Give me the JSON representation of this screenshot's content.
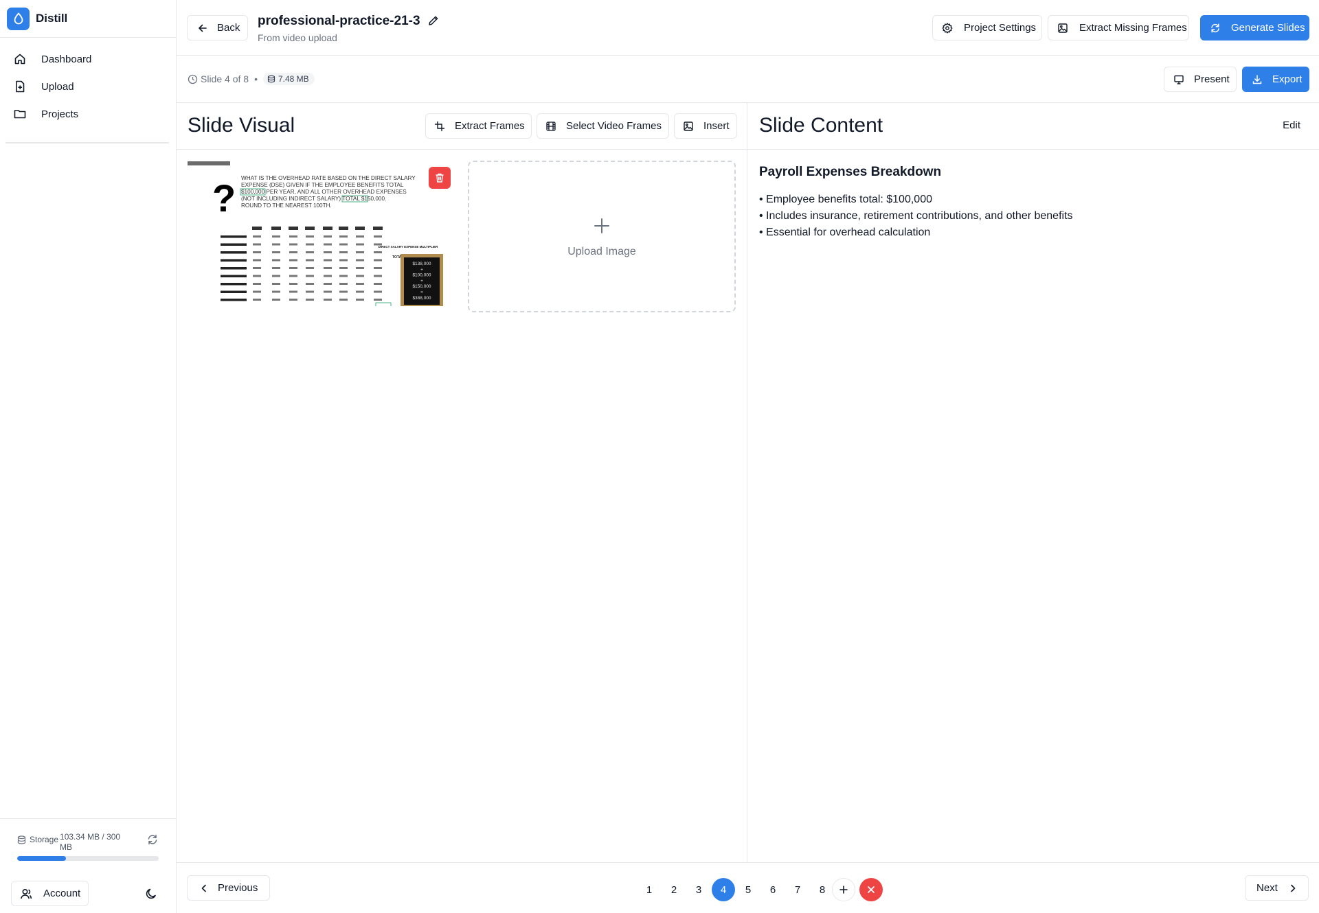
{
  "app": {
    "name": "Distill",
    "accent": "#2f7fe8",
    "danger": "#ef4444"
  },
  "sidebar": {
    "items": [
      {
        "label": "Dashboard",
        "icon": "home-icon"
      },
      {
        "label": "Upload",
        "icon": "file-plus-icon"
      },
      {
        "label": "Projects",
        "icon": "folder-icon"
      }
    ],
    "storage": {
      "label": "Storage",
      "value": "103.34 MB / 300 MB",
      "used_fraction": 0.344
    },
    "account_label": "Account"
  },
  "header": {
    "back_label": "Back",
    "project_title": "professional-practice-21-3",
    "project_subtitle": "From video upload",
    "project_settings_label": "Project Settings",
    "extract_missing_label": "Extract Missing Frames",
    "generate_label": "Generate Slides"
  },
  "subbar": {
    "slide_indicator": "Slide 4 of 8",
    "separator": "•",
    "file_size": "7.48 MB",
    "present_label": "Present",
    "export_label": "Export"
  },
  "visual": {
    "title": "Slide Visual",
    "extract_frames_label": "Extract Frames",
    "select_video_frames_label": "Select Video Frames",
    "insert_label": "Insert",
    "upload_label": "Upload Image",
    "frame": {
      "question_mark": "?",
      "question_lines": [
        "WHAT IS THE OVERHEAD RATE BASED ON THE DIRECT SALARY",
        "EXPENSE (DSE) GIVEN IF THE EMPLOYEE BENEFITS TOTAL",
        "$100,000 PER YEAR, AND ALL OTHER OVERHEAD EXPENSES",
        "(NOT INCLUDING INDIRECT SALARY) TOTAL $150,000.",
        "ROUND TO THE NEAREST 100TH."
      ],
      "total_overhead_label": "TOTAL OVERHEAD",
      "board_lines": [
        "$138,000",
        "+",
        "$100,000",
        "+",
        "$150,000",
        "=",
        "$388,000"
      ],
      "multiplier_label": "DIRECT SALARY EXPENSE MULTIPLIER"
    }
  },
  "content": {
    "title": "Slide Content",
    "edit_label": "Edit",
    "heading": "Payroll Expenses Breakdown",
    "bullets": [
      "• Employee benefits total: $100,000",
      "• Includes insurance, retirement contributions, and other benefits",
      "• Essential for overhead calculation"
    ]
  },
  "pagination": {
    "previous_label": "Previous",
    "next_label": "Next",
    "pages": [
      "1",
      "2",
      "3",
      "4",
      "5",
      "6",
      "7",
      "8"
    ],
    "current": "4"
  }
}
